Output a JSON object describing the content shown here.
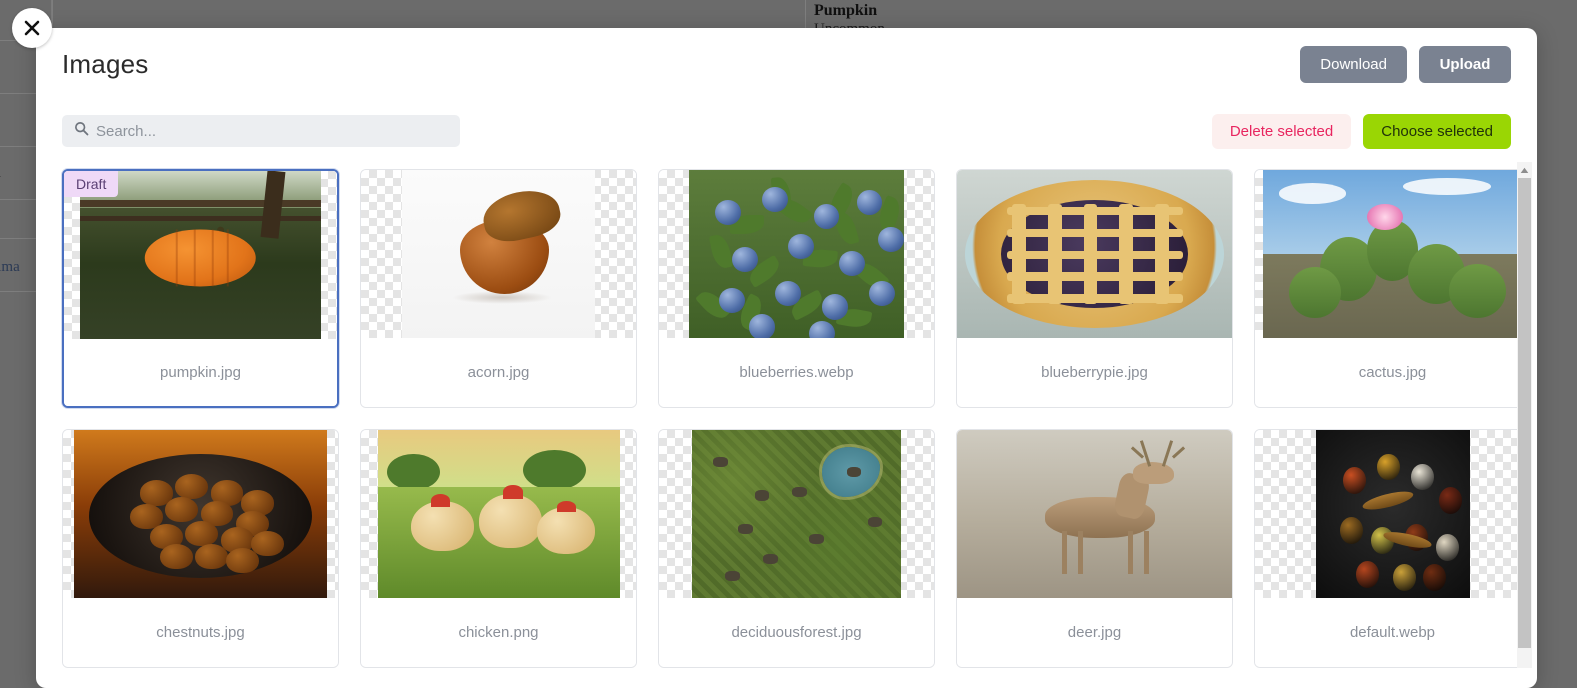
{
  "background": {
    "detail_title": "Pumpkin",
    "detail_subtitle": "Uncommon",
    "left_fragment_1": "on",
    "left_fragment_2": "n ima"
  },
  "close_button": {
    "name": "close",
    "glyph": "✕"
  },
  "modal": {
    "title": "Images",
    "header_buttons": [
      {
        "label": "Download",
        "name": "download-button"
      },
      {
        "label": "Upload",
        "name": "upload-button"
      }
    ],
    "search": {
      "placeholder": "Search...",
      "value": "",
      "icon": "search-icon"
    },
    "toolbar_buttons": [
      {
        "label": "Delete selected",
        "name": "delete-selected-button",
        "color": "#e8255f"
      },
      {
        "label": "Choose selected",
        "name": "choose-selected-button",
        "color": "#9ad604"
      }
    ],
    "scrollbar": {
      "up_arrow": "▲"
    },
    "items": [
      {
        "filename": "pumpkin.jpg",
        "badge": "Draft",
        "selected": true,
        "art": "pumpkin"
      },
      {
        "filename": "acorn.jpg",
        "badge": "",
        "selected": false,
        "art": "acorn"
      },
      {
        "filename": "blueberries.webp",
        "badge": "",
        "selected": false,
        "art": "blueberries"
      },
      {
        "filename": "blueberrypie.jpg",
        "badge": "",
        "selected": false,
        "art": "pie"
      },
      {
        "filename": "cactus.jpg",
        "badge": "",
        "selected": false,
        "art": "cactus"
      },
      {
        "filename": "chestnuts.jpg",
        "badge": "",
        "selected": false,
        "art": "chestnuts"
      },
      {
        "filename": "chicken.png",
        "badge": "",
        "selected": false,
        "art": "chicken"
      },
      {
        "filename": "deciduousforest.jpg",
        "badge": "",
        "selected": false,
        "art": "forest"
      },
      {
        "filename": "deer.jpg",
        "badge": "",
        "selected": false,
        "art": "deer"
      },
      {
        "filename": "default.webp",
        "badge": "",
        "selected": false,
        "art": "spices"
      }
    ]
  },
  "colors": {
    "accent_green": "#9ad604",
    "danger": "#e8255f",
    "grey_button": "#7a8291",
    "selected_border": "#4a6fc0",
    "badge_bg": "#efd9f7",
    "badge_text": "#5a3f73"
  }
}
